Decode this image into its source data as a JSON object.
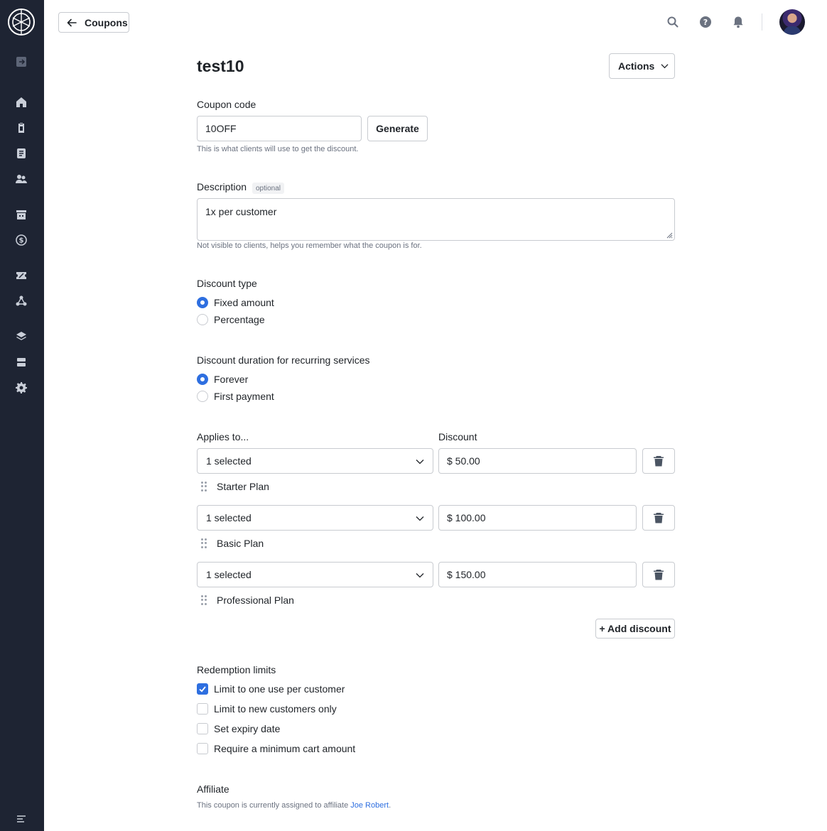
{
  "header": {
    "back_label": "Coupons"
  },
  "page": {
    "title": "test10",
    "actions_label": "Actions"
  },
  "coupon_code": {
    "label": "Coupon code",
    "value": "10OFF",
    "generate_label": "Generate",
    "help": "This is what clients will use to get the discount."
  },
  "description": {
    "label": "Description",
    "optional_tag": "optional",
    "value": "1x per customer",
    "help": "Not visible to clients, helps you remember what the coupon is for."
  },
  "discount_type": {
    "label": "Discount type",
    "options": [
      {
        "label": "Fixed amount",
        "selected": true
      },
      {
        "label": "Percentage",
        "selected": false
      }
    ]
  },
  "discount_duration": {
    "label": "Discount duration for recurring services",
    "options": [
      {
        "label": "Forever",
        "selected": true
      },
      {
        "label": "First payment",
        "selected": false
      }
    ]
  },
  "discounts": {
    "applies_label": "Applies to...",
    "discount_label": "Discount",
    "rows": [
      {
        "selection": "1 selected",
        "amount": "$ 50.00",
        "plan": "Starter Plan"
      },
      {
        "selection": "1 selected",
        "amount": "$ 100.00",
        "plan": "Basic Plan"
      },
      {
        "selection": "1 selected",
        "amount": "$ 150.00",
        "plan": "Professional Plan"
      }
    ],
    "add_label": "+ Add discount"
  },
  "redemption": {
    "label": "Redemption limits",
    "options": [
      {
        "label": "Limit to one use per customer",
        "checked": true
      },
      {
        "label": "Limit to new customers only",
        "checked": false
      },
      {
        "label": "Set expiry date",
        "checked": false
      },
      {
        "label": "Require a minimum cart amount",
        "checked": false
      }
    ]
  },
  "affiliate": {
    "label": "Affiliate",
    "text_before": "This coupon is currently assigned to affiliate ",
    "link": "Joe Robert",
    "text_after": "."
  },
  "colors": {
    "sidebar_bg": "#1e2433",
    "accent": "#2e6fe0"
  },
  "icons": {
    "sidebar": [
      "collapse-icon",
      "home-icon",
      "clipboard-icon",
      "document-icon",
      "users-icon",
      "building-icon",
      "dollar-icon",
      "ticket-icon",
      "network-icon",
      "layers-icon",
      "server-icon",
      "settings-icon",
      "menu-icon"
    ],
    "top": [
      "search-icon",
      "help-icon",
      "bell-icon"
    ]
  }
}
